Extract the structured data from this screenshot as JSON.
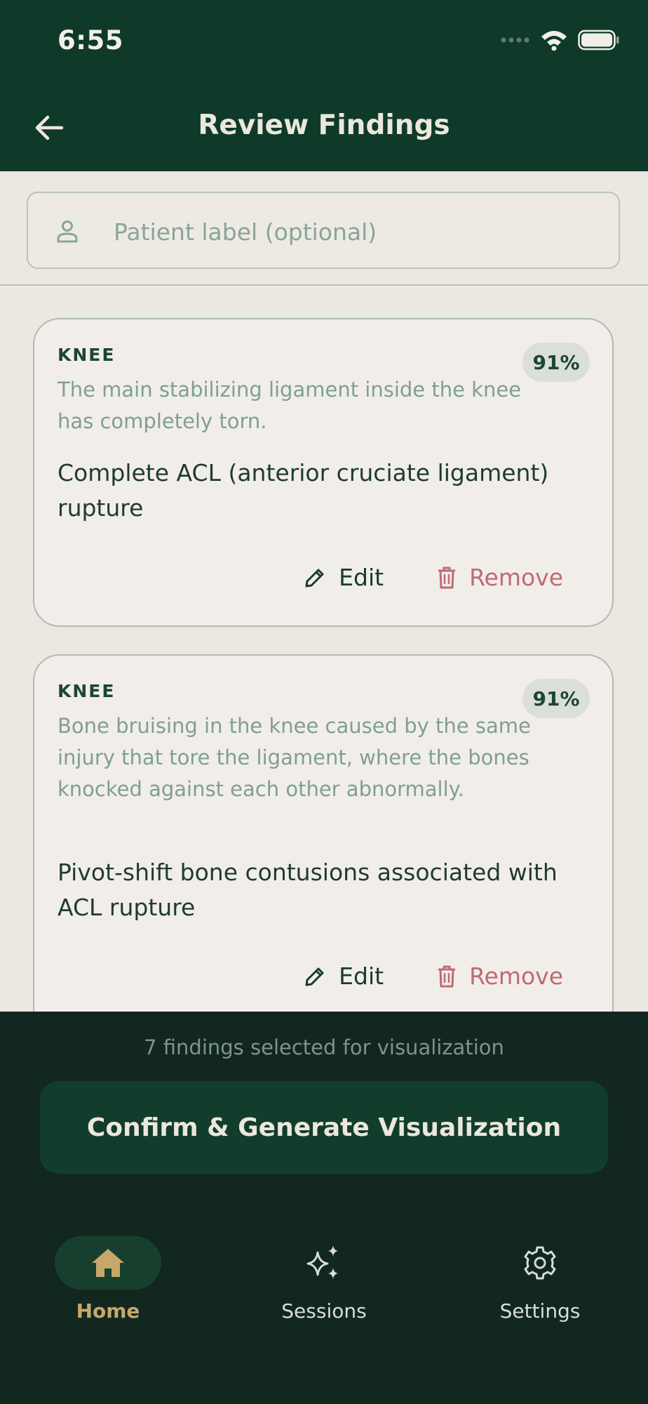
{
  "status_bar": {
    "time": "6:55"
  },
  "app_bar": {
    "title": "Review Findings"
  },
  "patient_field": {
    "placeholder": "Patient label (optional)"
  },
  "findings": [
    {
      "region": "KNEE",
      "confidence": "91%",
      "plain_text": "The main stabilizing ligament inside the knee has completely torn.",
      "clinical_text": "Complete ACL (anterior cruciate ligament) rupture",
      "edit_label": "Edit",
      "remove_label": "Remove"
    },
    {
      "region": "KNEE",
      "confidence": "91%",
      "plain_text": "Bone bruising in the knee caused by the same injury that tore the ligament, where the bones knocked against each other abnormally.",
      "clinical_text": "Pivot-shift bone contusions associated with ACL rupture",
      "edit_label": "Edit",
      "remove_label": "Remove"
    }
  ],
  "footer": {
    "selected_count": "7 findings selected for visualization",
    "confirm_label": "Confirm & Generate Visualization"
  },
  "nav": {
    "items": [
      {
        "label": "Home",
        "icon": "home-icon",
        "active": true
      },
      {
        "label": "Sessions",
        "icon": "sparkles-icon",
        "active": false
      },
      {
        "label": "Settings",
        "icon": "gear-icon",
        "active": false
      }
    ]
  },
  "colors": {
    "header_bg": "#0f3a2a",
    "accent_gold": "#c7a86a",
    "remove_red": "#c06a73"
  }
}
